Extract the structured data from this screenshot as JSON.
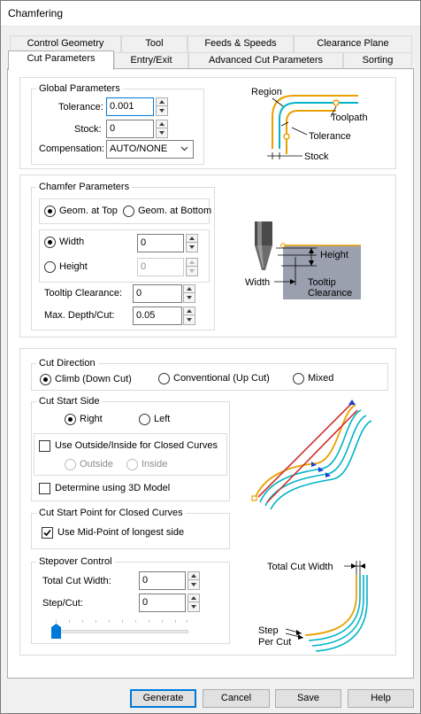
{
  "window": {
    "title": "Chamfering"
  },
  "tabs_row1": [
    {
      "label": "Control Geometry"
    },
    {
      "label": "Tool"
    },
    {
      "label": "Feeds & Speeds"
    },
    {
      "label": "Clearance Plane"
    }
  ],
  "tabs_row2": [
    {
      "label": "Cut Parameters",
      "active": true
    },
    {
      "label": "Entry/Exit"
    },
    {
      "label": "Advanced Cut Parameters"
    },
    {
      "label": "Sorting"
    }
  ],
  "global": {
    "title": "Global Parameters",
    "tolerance_label": "Tolerance:",
    "tolerance_value": "0.001",
    "stock_label": "Stock:",
    "stock_value": "0",
    "compensation_label": "Compensation:",
    "compensation_value": "AUTO/NONE"
  },
  "diagram1": {
    "region": "Region",
    "toolpath": "Toolpath",
    "tolerance": "Tolerance",
    "stock": "Stock"
  },
  "chamfer": {
    "title": "Chamfer Parameters",
    "geom_top": "Geom. at Top",
    "geom_bottom": "Geom. at Bottom",
    "width_label": "Width",
    "width_value": "0",
    "height_label": "Height",
    "height_value": "0",
    "tooltip_label": "Tooltip Clearance:",
    "tooltip_value": "0",
    "maxdepth_label": "Max. Depth/Cut:",
    "maxdepth_value": "0.05"
  },
  "diagram2": {
    "height": "Height",
    "width": "Width",
    "tooltip_line1": "Tooltip",
    "tooltip_line2": "Clearance"
  },
  "cut_direction": {
    "title": "Cut Direction",
    "climb": "Climb (Down Cut)",
    "conventional": "Conventional (Up Cut)",
    "mixed": "Mixed"
  },
  "cut_start_side": {
    "title": "Cut Start Side",
    "right": "Right",
    "left": "Left",
    "use_outside_inside": "Use Outside/Inside for Closed Curves",
    "outside": "Outside",
    "inside": "Inside",
    "determine_3d": "Determine using 3D Model"
  },
  "cut_start_point": {
    "title": "Cut Start Point for Closed Curves",
    "use_midpoint": "Use Mid-Point of longest side"
  },
  "stepover": {
    "title": "Stepover Control",
    "total_label": "Total Cut Width:",
    "total_value": "0",
    "step_label": "Step/Cut:",
    "step_value": "0",
    "slider_level": 0
  },
  "diagram4": {
    "total": "Total Cut Width",
    "step_line1": "Step",
    "step_line2": "Per Cut"
  },
  "buttons": {
    "generate": "Generate",
    "cancel": "Cancel",
    "save": "Save",
    "help": "Help"
  },
  "colors": {
    "accent": "#0078d7",
    "curve_orange": "#e8a000",
    "curve_cyan": "#00b4c8",
    "curve_red": "#d03030",
    "tool_gray": "#9aa0ae",
    "arrow_blue": "#1a3fd0"
  }
}
